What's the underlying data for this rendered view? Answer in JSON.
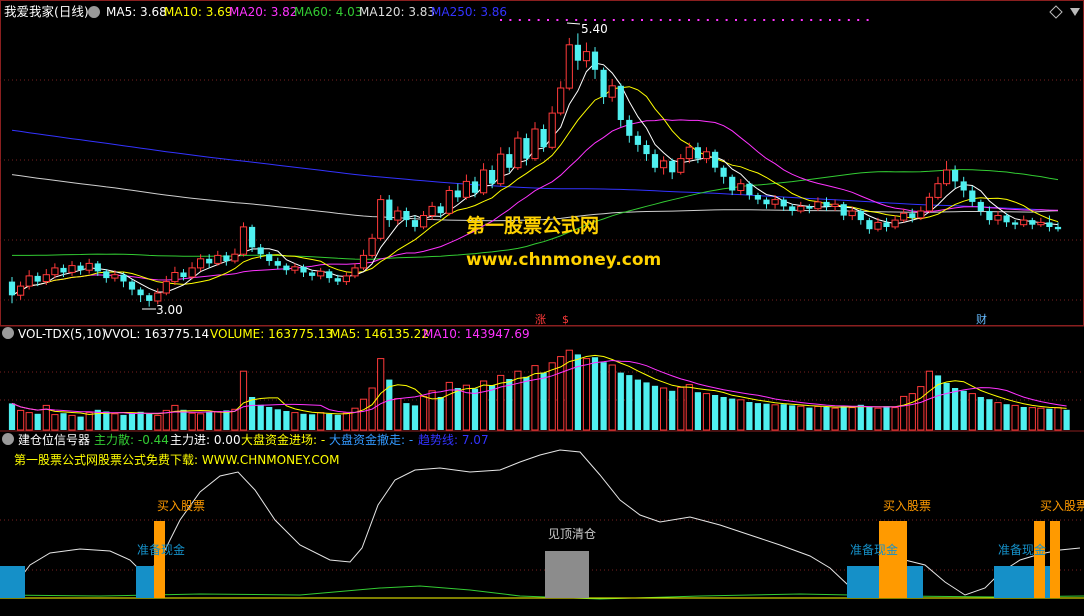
{
  "colors": {
    "background": "#000000",
    "panel_border": "#8a1f1f",
    "grid_dot": "#7a1f1f",
    "up_candle": "#ff3a3a",
    "down_candle": "#4ff0f0",
    "ma5": "#ffffff",
    "ma10": "#ffff00",
    "ma20": "#ff33ff",
    "ma60": "#33cc33",
    "ma120": "#cfcfcf",
    "ma250": "#3333ff",
    "watermark": "#ffd200",
    "signal_blue": "#1590c8",
    "signal_orange": "#ff9a00",
    "signal_gray": "#8c8c8c"
  },
  "header": {
    "name": "我爱我家(日线)",
    "ma5": "MA5: 3.68",
    "ma10": "MA10: 3.69",
    "ma20": "MA20: 3.82",
    "ma60": "MA60: 4.03",
    "ma120": "MA120: 3.83",
    "ma250": "MA250: 3.86"
  },
  "price_labels": {
    "high": "5.40",
    "low": "3.00",
    "event_zhang": "涨",
    "event_s": "$",
    "event_cai": "财"
  },
  "watermark": {
    "title": "第一股票公式网",
    "url": "www.chnmoney.com"
  },
  "volume_header": {
    "name": "VOL-TDX(5,10)",
    "vvol": "VVOL: 163775.14",
    "volume": "VOLUME: 163775.13",
    "ma5": "MA5: 146135.22",
    "ma10": "MA10: 143947.69"
  },
  "signal_header": {
    "name": "建仓位信号器",
    "zhuli_san": "主力散: -0.44",
    "zhuli_jin": "主力进: 0.00",
    "dapan_jin": "大盘资金进场: -",
    "dapan_zou": "大盘资金撤走: -",
    "qushi": "趋势线: 7.07",
    "promo": "第一股票公式网股票公式免费下载: WWW.CHNMONEY.COM"
  },
  "signal_labels": {
    "buy": "买入股票",
    "prepare": "准备现金",
    "clear": "见顶清仓"
  },
  "chart_data": [
    {
      "type": "candlestick",
      "title": "我爱我家(日线)",
      "ylim": [
        2.9,
        5.5
      ],
      "annotations": {
        "high": 5.4,
        "low": 3.0
      },
      "ma_last": {
        "MA5": 3.68,
        "MA10": 3.69,
        "MA20": 3.82,
        "MA60": 4.03,
        "MA120": 3.83,
        "MA250": 3.86
      },
      "candles": [
        [
          3.22,
          3.1,
          3.26,
          3.03
        ],
        [
          3.1,
          3.18,
          3.22,
          3.06
        ],
        [
          3.18,
          3.27,
          3.32,
          3.15
        ],
        [
          3.27,
          3.22,
          3.3,
          3.18
        ],
        [
          3.22,
          3.28,
          3.33,
          3.19
        ],
        [
          3.28,
          3.34,
          3.38,
          3.25
        ],
        [
          3.34,
          3.3,
          3.37,
          3.26
        ],
        [
          3.3,
          3.36,
          3.4,
          3.27
        ],
        [
          3.36,
          3.32,
          3.39,
          3.28
        ],
        [
          3.32,
          3.38,
          3.42,
          3.29
        ],
        [
          3.38,
          3.31,
          3.4,
          3.27
        ],
        [
          3.31,
          3.25,
          3.33,
          3.21
        ],
        [
          3.25,
          3.28,
          3.32,
          3.22
        ],
        [
          3.28,
          3.22,
          3.3,
          3.17
        ],
        [
          3.22,
          3.15,
          3.24,
          3.1
        ],
        [
          3.15,
          3.1,
          3.17,
          3.04
        ],
        [
          3.1,
          3.05,
          3.12,
          3.0
        ],
        [
          3.05,
          3.12,
          3.16,
          3.02
        ],
        [
          3.12,
          3.22,
          3.27,
          3.1
        ],
        [
          3.22,
          3.3,
          3.35,
          3.19
        ],
        [
          3.3,
          3.26,
          3.33,
          3.23
        ],
        [
          3.26,
          3.34,
          3.39,
          3.24
        ],
        [
          3.34,
          3.42,
          3.46,
          3.31
        ],
        [
          3.42,
          3.38,
          3.46,
          3.34
        ],
        [
          3.38,
          3.45,
          3.49,
          3.36
        ],
        [
          3.45,
          3.4,
          3.48,
          3.36
        ],
        [
          3.4,
          3.46,
          3.51,
          3.38
        ],
        [
          3.46,
          3.7,
          3.74,
          3.44
        ],
        [
          3.7,
          3.52,
          3.72,
          3.48
        ],
        [
          3.52,
          3.46,
          3.55,
          3.42
        ],
        [
          3.46,
          3.4,
          3.48,
          3.36
        ],
        [
          3.4,
          3.36,
          3.43,
          3.33
        ],
        [
          3.36,
          3.32,
          3.38,
          3.28
        ],
        [
          3.32,
          3.35,
          3.38,
          3.29
        ],
        [
          3.35,
          3.3,
          3.37,
          3.26
        ],
        [
          3.3,
          3.27,
          3.32,
          3.23
        ],
        [
          3.27,
          3.31,
          3.34,
          3.24
        ],
        [
          3.31,
          3.25,
          3.33,
          3.21
        ],
        [
          3.25,
          3.22,
          3.28,
          3.19
        ],
        [
          3.22,
          3.27,
          3.3,
          3.19
        ],
        [
          3.27,
          3.34,
          3.38,
          3.25
        ],
        [
          3.34,
          3.45,
          3.5,
          3.32
        ],
        [
          3.45,
          3.6,
          3.64,
          3.43
        ],
        [
          3.6,
          3.94,
          3.98,
          3.58
        ],
        [
          3.94,
          3.76,
          3.98,
          3.7
        ],
        [
          3.76,
          3.84,
          3.88,
          3.72
        ],
        [
          3.84,
          3.76,
          3.87,
          3.7
        ],
        [
          3.76,
          3.7,
          3.8,
          3.66
        ],
        [
          3.7,
          3.8,
          3.84,
          3.68
        ],
        [
          3.8,
          3.88,
          3.92,
          3.76
        ],
        [
          3.88,
          3.82,
          3.91,
          3.78
        ],
        [
          3.82,
          4.02,
          4.06,
          3.8
        ],
        [
          4.02,
          3.96,
          4.08,
          3.92
        ],
        [
          3.96,
          4.1,
          4.16,
          3.94
        ],
        [
          4.1,
          4.0,
          4.14,
          3.96
        ],
        [
          4.0,
          4.2,
          4.26,
          3.98
        ],
        [
          4.2,
          4.08,
          4.24,
          4.04
        ],
        [
          4.08,
          4.34,
          4.4,
          4.06
        ],
        [
          4.34,
          4.22,
          4.4,
          4.18
        ],
        [
          4.22,
          4.48,
          4.54,
          4.2
        ],
        [
          4.48,
          4.3,
          4.52,
          4.24
        ],
        [
          4.3,
          4.56,
          4.62,
          4.28
        ],
        [
          4.56,
          4.4,
          4.6,
          4.36
        ],
        [
          4.4,
          4.7,
          4.76,
          4.38
        ],
        [
          4.7,
          4.92,
          4.98,
          4.68
        ],
        [
          4.92,
          5.3,
          5.36,
          4.9
        ],
        [
          5.3,
          5.16,
          5.4,
          5.08
        ],
        [
          5.16,
          5.24,
          5.32,
          5.1
        ],
        [
          5.24,
          5.08,
          5.28,
          5.0
        ],
        [
          5.08,
          4.84,
          5.1,
          4.78
        ],
        [
          4.84,
          4.94,
          5.0,
          4.8
        ],
        [
          4.94,
          4.64,
          4.96,
          4.58
        ],
        [
          4.64,
          4.5,
          4.68,
          4.44
        ],
        [
          4.5,
          4.42,
          4.54,
          4.36
        ],
        [
          4.42,
          4.34,
          4.46,
          4.28
        ],
        [
          4.34,
          4.22,
          4.38,
          4.18
        ],
        [
          4.22,
          4.28,
          4.32,
          4.16
        ],
        [
          4.28,
          4.18,
          4.3,
          4.12
        ],
        [
          4.18,
          4.3,
          4.34,
          4.16
        ],
        [
          4.3,
          4.4,
          4.44,
          4.26
        ],
        [
          4.4,
          4.3,
          4.44,
          4.26
        ],
        [
          4.3,
          4.36,
          4.4,
          4.26
        ],
        [
          4.36,
          4.22,
          4.38,
          4.18
        ],
        [
          4.22,
          4.14,
          4.24,
          4.08
        ],
        [
          4.14,
          4.02,
          4.16,
          3.98
        ],
        [
          4.02,
          4.08,
          4.12,
          3.98
        ],
        [
          4.08,
          3.98,
          4.1,
          3.94
        ],
        [
          3.98,
          3.94,
          4.0,
          3.9
        ],
        [
          3.94,
          3.9,
          3.96,
          3.86
        ],
        [
          3.9,
          3.94,
          3.98,
          3.86
        ],
        [
          3.94,
          3.88,
          3.96,
          3.84
        ],
        [
          3.88,
          3.84,
          3.9,
          3.8
        ],
        [
          3.84,
          3.88,
          3.92,
          3.82
        ],
        [
          3.88,
          3.86,
          3.9,
          3.82
        ],
        [
          3.86,
          3.92,
          3.96,
          3.84
        ],
        [
          3.92,
          3.88,
          3.96,
          3.84
        ],
        [
          3.88,
          3.9,
          3.94,
          3.84
        ],
        [
          3.9,
          3.8,
          3.92,
          3.76
        ],
        [
          3.8,
          3.84,
          3.88,
          3.76
        ],
        [
          3.84,
          3.76,
          3.86,
          3.72
        ],
        [
          3.76,
          3.68,
          3.78,
          3.64
        ],
        [
          3.68,
          3.74,
          3.78,
          3.66
        ],
        [
          3.74,
          3.7,
          3.78,
          3.66
        ],
        [
          3.7,
          3.76,
          3.8,
          3.68
        ],
        [
          3.76,
          3.82,
          3.86,
          3.74
        ],
        [
          3.82,
          3.78,
          3.86,
          3.74
        ],
        [
          3.78,
          3.84,
          3.88,
          3.76
        ],
        [
          3.84,
          3.96,
          4.0,
          3.82
        ],
        [
          3.96,
          4.08,
          4.14,
          3.94
        ],
        [
          4.08,
          4.2,
          4.28,
          4.06
        ],
        [
          4.2,
          4.1,
          4.24,
          4.04
        ],
        [
          4.1,
          4.02,
          4.14,
          3.96
        ],
        [
          4.02,
          3.92,
          4.06,
          3.88
        ],
        [
          3.92,
          3.84,
          3.94,
          3.8
        ],
        [
          3.84,
          3.76,
          3.88,
          3.72
        ],
        [
          3.76,
          3.8,
          3.84,
          3.72
        ],
        [
          3.8,
          3.74,
          3.82,
          3.7
        ],
        [
          3.74,
          3.72,
          3.76,
          3.68
        ],
        [
          3.72,
          3.76,
          3.8,
          3.7
        ],
        [
          3.76,
          3.72,
          3.78,
          3.68
        ],
        [
          3.72,
          3.74,
          3.78,
          3.7
        ],
        [
          3.74,
          3.7,
          3.8,
          3.66
        ],
        [
          3.7,
          3.68,
          3.74,
          3.66
        ]
      ]
    },
    {
      "type": "bar",
      "title": "VOL-TDX(5,10)",
      "ylim": [
        0,
        300000
      ],
      "ma_last": {
        "MA5": 146135.22,
        "MA10": 143947.69
      },
      "values": [
        95000,
        70000,
        62000,
        58000,
        88000,
        55000,
        60000,
        52000,
        48000,
        62000,
        72000,
        66000,
        58000,
        54000,
        60000,
        65000,
        58000,
        52000,
        70000,
        88000,
        72000,
        60000,
        58000,
        64000,
        66000,
        70000,
        74000,
        210000,
        118000,
        90000,
        82000,
        74000,
        68000,
        62000,
        58000,
        56000,
        62000,
        58000,
        54000,
        60000,
        78000,
        110000,
        150000,
        255000,
        180000,
        112000,
        96000,
        88000,
        120000,
        140000,
        118000,
        170000,
        150000,
        160000,
        148000,
        175000,
        160000,
        195000,
        182000,
        210000,
        190000,
        230000,
        205000,
        240000,
        262000,
        285000,
        270000,
        255000,
        260000,
        242000,
        232000,
        205000,
        196000,
        180000,
        170000,
        158000,
        150000,
        140000,
        152000,
        162000,
        135000,
        130000,
        125000,
        118000,
        112000,
        108000,
        100000,
        96000,
        94000,
        90000,
        92000,
        88000,
        85000,
        80000,
        84000,
        82000,
        78000,
        86000,
        80000,
        90000,
        82000,
        78000,
        85000,
        80000,
        120000,
        130000,
        155000,
        210000,
        195000,
        168000,
        150000,
        140000,
        130000,
        118000,
        110000,
        98000,
        92000,
        88000,
        82000,
        80000,
        78000,
        76000,
        80000,
        72000
      ],
      "up": [
        false,
        true,
        true,
        false,
        true,
        true,
        false,
        true,
        false,
        true,
        false,
        false,
        true,
        false,
        false,
        false,
        false,
        true,
        true,
        true,
        false,
        true,
        true,
        false,
        true,
        false,
        true,
        true,
        false,
        false,
        false,
        false,
        false,
        true,
        false,
        false,
        true,
        false,
        false,
        true,
        true,
        true,
        true,
        true,
        false,
        true,
        false,
        false,
        true,
        true,
        false,
        true,
        false,
        true,
        false,
        true,
        false,
        true,
        false,
        true,
        false,
        true,
        false,
        true,
        true,
        true,
        false,
        true,
        false,
        false,
        true,
        false,
        false,
        false,
        false,
        false,
        true,
        false,
        true,
        true,
        false,
        true,
        false,
        false,
        false,
        true,
        false,
        false,
        false,
        true,
        false,
        false,
        true,
        false,
        true,
        false,
        true,
        false,
        true,
        false,
        false,
        true,
        false,
        true,
        true,
        true,
        true,
        true,
        false,
        false,
        false,
        false,
        true,
        false,
        false,
        true,
        false,
        true,
        false,
        true,
        true,
        false,
        true,
        false
      ]
    },
    {
      "type": "signal",
      "title": "建仓位信号器",
      "values": {
        "主力散": -0.44,
        "主力进": 0.0,
        "趋势线": 7.07
      }
    }
  ]
}
